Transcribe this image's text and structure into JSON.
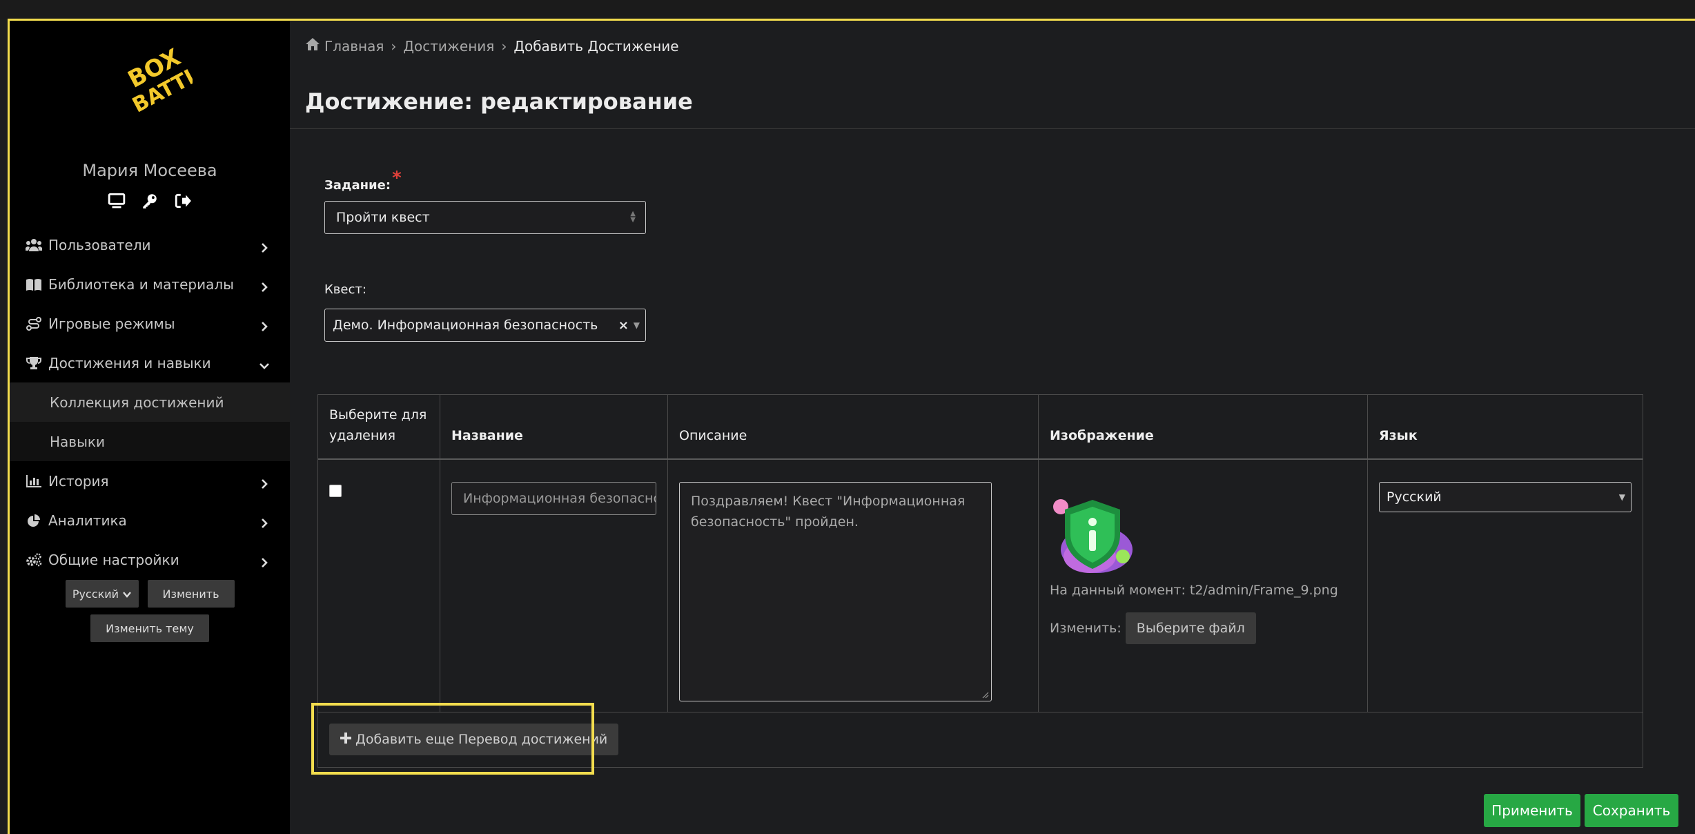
{
  "sidebar": {
    "user_name": "Мария Мосеева",
    "user_icons": [
      "monitor-icon",
      "key-icon",
      "sign-out-icon"
    ],
    "nav": [
      {
        "label": "Пользователи",
        "icon": "users-icon"
      },
      {
        "label": "Библиотека и материалы",
        "icon": "book-icon"
      },
      {
        "label": "Игровые режимы",
        "icon": "route-icon"
      },
      {
        "label": "Достижения и навыки",
        "icon": "trophy-icon",
        "expanded": true
      },
      {
        "label": "История",
        "icon": "chart-bar-icon"
      },
      {
        "label": "Аналитика",
        "icon": "chart-pie-icon"
      },
      {
        "label": "Общие настройки",
        "icon": "cogs-icon"
      }
    ],
    "sub_items": [
      "Коллекция достижений",
      "Навыки"
    ],
    "language_value": "Русский",
    "change_button": "Изменить",
    "change_theme_button": "Изменить тему"
  },
  "breadcrumb": {
    "home": "Главная",
    "level2": "Достижения",
    "current": "Добавить  Достижение",
    "separator": "›"
  },
  "page_title": "Достижение: редактирование",
  "form": {
    "task_label": "Задание:",
    "task_required": "*",
    "task_value": "Пройти квест",
    "quest_label": "Квест:",
    "quest_value": "Демо. Информационная безопасность",
    "quest_clear": "×"
  },
  "table": {
    "headers": {
      "select_line1": "Выберите для",
      "select_line2": "удаления",
      "name": "Название",
      "description": "Описание",
      "image": "Изображение",
      "language": "Язык"
    },
    "row": {
      "name_value": "Информационная безопасность",
      "description_value": "Поздравляем! Квест \"Информационная безопасность\" пройден.",
      "image_current": "На данный момент: t2/admin/Frame_9.png",
      "image_change_label": "Изменить:",
      "file_button": "Выберите файл",
      "language_value": "Русский"
    },
    "add_button": "Добавить еще Перевод достижений"
  },
  "actions": {
    "apply": "Применить",
    "save": "Сохранить"
  },
  "colors": {
    "accent_yellow": "#f3dd4e",
    "success_green": "#27a844",
    "required_red": "#e0403a"
  }
}
